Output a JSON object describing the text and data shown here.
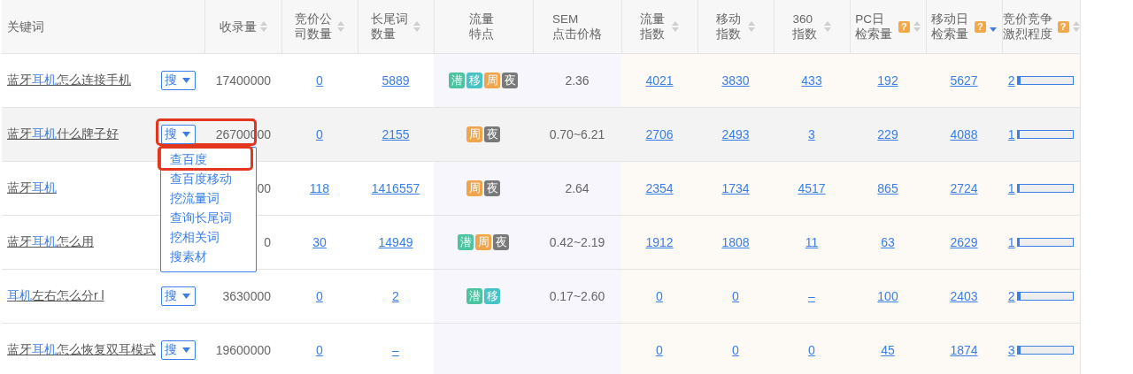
{
  "columns": [
    {
      "label": "关键词",
      "sortable": false
    },
    {
      "label": "收录量",
      "sortable": true,
      "sorted_desc": false
    },
    {
      "label": "竞价公司数量",
      "sortable": true,
      "sorted_desc": false
    },
    {
      "label": "长尾词数量",
      "sortable": true,
      "sorted_desc": false
    },
    {
      "label": "流量特点",
      "sortable": false
    },
    {
      "label": "SEM\n点击价格",
      "sortable": false
    },
    {
      "label": "流量指数",
      "sortable": true,
      "sorted_desc": false
    },
    {
      "label": "移动指数",
      "sortable": true,
      "sorted_desc": false
    },
    {
      "label": "360指数",
      "sortable": true,
      "sorted_desc": false
    },
    {
      "label": "PC日检索量",
      "sortable": true,
      "sorted_desc": false,
      "help": "?"
    },
    {
      "label": "移动日检索量",
      "sortable": true,
      "sorted_desc": true,
      "help": "?"
    },
    {
      "label": "竞价竞争激烈程度",
      "sortable": true,
      "sorted_desc": false,
      "help": "?"
    }
  ],
  "rows": [
    {
      "keyword": [
        {
          "text": "蓝牙",
          "match": false
        },
        {
          "text": "耳机",
          "match": true
        },
        {
          "text": "怎么连接手机",
          "match": false
        }
      ],
      "search_button": "搜",
      "hovered": false,
      "menu_open": false,
      "count": "17400000",
      "bid_companies": "0",
      "longtail": "5889",
      "tags": [
        {
          "label": "潜",
          "color": "#4dc3a0"
        },
        {
          "label": "移",
          "color": "#47c2c6"
        },
        {
          "label": "周",
          "color": "#f0a54c"
        },
        {
          "label": "夜",
          "color": "#797979"
        }
      ],
      "sem": "2.36",
      "flow": "4021",
      "mobile": "3830",
      "idx360": "433",
      "pc_daily": "192",
      "mobile_daily": "5627",
      "competition": "2",
      "level": 0.05
    },
    {
      "keyword": [
        {
          "text": "蓝牙",
          "match": false
        },
        {
          "text": "耳机",
          "match": true
        },
        {
          "text": "什么牌子好",
          "match": false
        }
      ],
      "search_button": "搜",
      "hovered": true,
      "menu_open": true,
      "count": "26700000",
      "bid_companies": "0",
      "longtail": "2155",
      "tags": [
        {
          "label": "周",
          "color": "#f0a54c"
        },
        {
          "label": "夜",
          "color": "#797979"
        }
      ],
      "sem": "0.70~6.21",
      "flow": "2706",
      "mobile": "2493",
      "idx360": "3",
      "pc_daily": "229",
      "mobile_daily": "4088",
      "competition": "1",
      "level": 0.03
    },
    {
      "keyword": [
        {
          "text": "蓝牙",
          "match": false
        },
        {
          "text": "耳机",
          "match": true
        }
      ],
      "hovered": false,
      "menu_open": false,
      "count": "00",
      "bid_companies": "118",
      "longtail": "1416557",
      "tags": [
        {
          "label": "周",
          "color": "#f0a54c"
        },
        {
          "label": "夜",
          "color": "#797979"
        }
      ],
      "sem": "2.64",
      "flow": "2354",
      "mobile": "1734",
      "idx360": "4517",
      "pc_daily": "865",
      "mobile_daily": "2724",
      "competition": "1",
      "level": 0.03
    },
    {
      "keyword": [
        {
          "text": "蓝牙",
          "match": false
        },
        {
          "text": "耳机",
          "match": true
        },
        {
          "text": "怎么用",
          "match": false
        }
      ],
      "hovered": false,
      "menu_open": false,
      "count": "0",
      "bid_companies": "30",
      "longtail": "14949",
      "tags": [
        {
          "label": "潜",
          "color": "#4dc3a0"
        },
        {
          "label": "周",
          "color": "#f0a54c"
        },
        {
          "label": "夜",
          "color": "#797979"
        }
      ],
      "sem": "0.42~2.19",
      "flow": "1912",
      "mobile": "1808",
      "idx360": "11",
      "pc_daily": "63",
      "mobile_daily": "2629",
      "competition": "1",
      "level": 0.03
    },
    {
      "keyword": [
        {
          "text": "耳机",
          "match": true
        },
        {
          "text": "左右怎么分r l",
          "match": false
        }
      ],
      "search_button": "搜",
      "hovered": false,
      "menu_open": false,
      "count": "3630000",
      "bid_companies": "0",
      "longtail": "2",
      "tags": [
        {
          "label": "潜",
          "color": "#4dc3a0"
        },
        {
          "label": "移",
          "color": "#47c2c6"
        }
      ],
      "sem": "0.17~2.60",
      "flow": "0",
      "mobile": "0",
      "idx360": "–",
      "pc_daily": "100",
      "mobile_daily": "2403",
      "competition": "2",
      "level": 0.05
    },
    {
      "keyword": [
        {
          "text": "蓝牙",
          "match": false
        },
        {
          "text": "耳机",
          "match": true
        },
        {
          "text": "怎么恢复双耳模式",
          "match": false
        }
      ],
      "search_button": "搜",
      "hovered": false,
      "menu_open": false,
      "count": "19600000",
      "bid_companies": "0",
      "longtail": "–",
      "tags": [],
      "sem": "",
      "flow": "0",
      "mobile": "0",
      "idx360": "0",
      "pc_daily": "45",
      "mobile_daily": "1874",
      "competition": "3",
      "level": 0.06
    }
  ],
  "search_menu": [
    "查百度",
    "查百度移动",
    "挖流量词",
    "查询长尾词",
    "挖相关词",
    "搜素材"
  ]
}
